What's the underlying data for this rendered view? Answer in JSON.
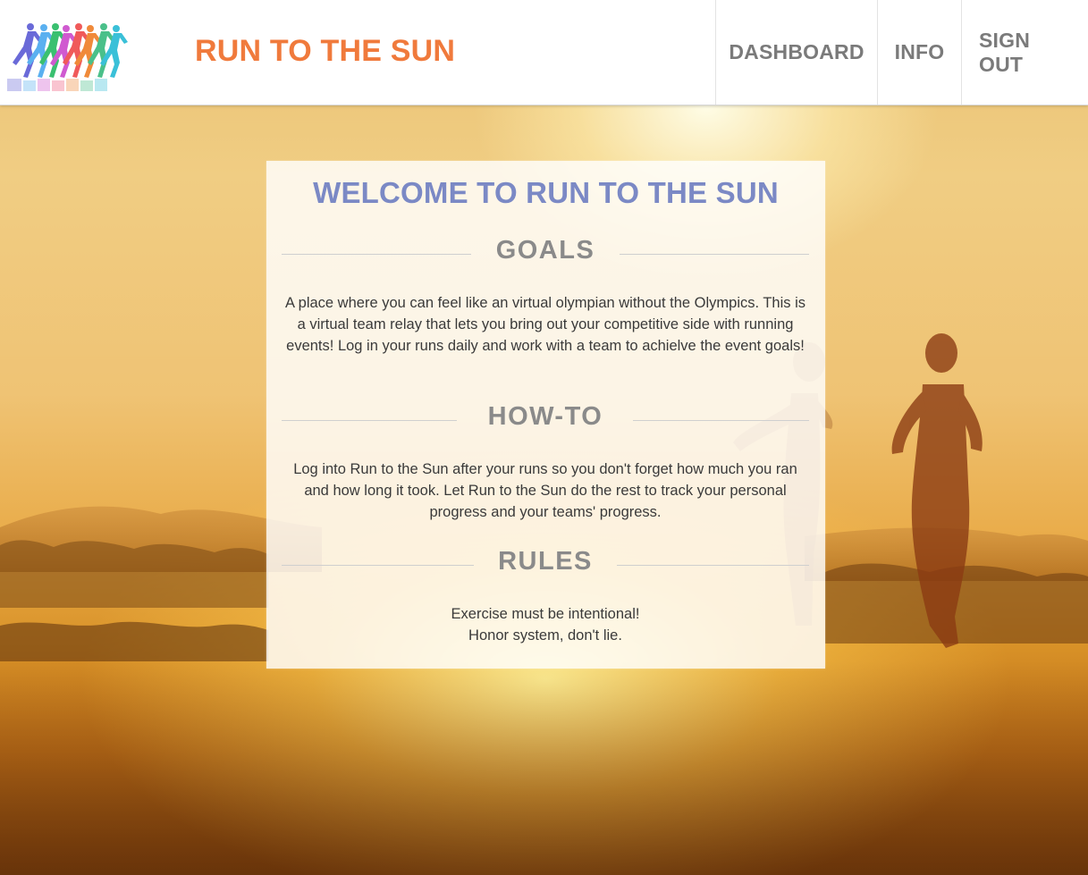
{
  "header": {
    "brand": "RUN TO THE SUN",
    "logo_icon": "colorful-runners-logo-icon",
    "nav": [
      {
        "label": "DASHBOARD"
      },
      {
        "label": "INFO"
      },
      {
        "label": "SIGN OUT"
      }
    ]
  },
  "panel": {
    "title": "WELCOME TO RUN TO THE SUN",
    "goals": {
      "heading": "GOALS",
      "text": "A place where you can feel like an virtual olympian without the Olympics. This is a virtual team relay that lets you bring out your competitive side with running events! Log in your runs daily and work with a team to achielve the event goals!"
    },
    "howto": {
      "heading": "HOW-TO",
      "text": "Log into Run to the Sun after your runs so you don't forget how much you ran and how long it took. Let Run to the Sun do the rest to track your personal progress and your teams' progress."
    },
    "rules": {
      "heading": "RULES",
      "lines": [
        "Exercise must be intentional!",
        "Honor system, don't lie."
      ]
    }
  },
  "colors": {
    "brand": "#f07a3c",
    "title": "#7b89c5",
    "nav_text": "#7a7a7a",
    "section_heading": "#8a8a8a",
    "body_text": "#3a3a3a"
  }
}
